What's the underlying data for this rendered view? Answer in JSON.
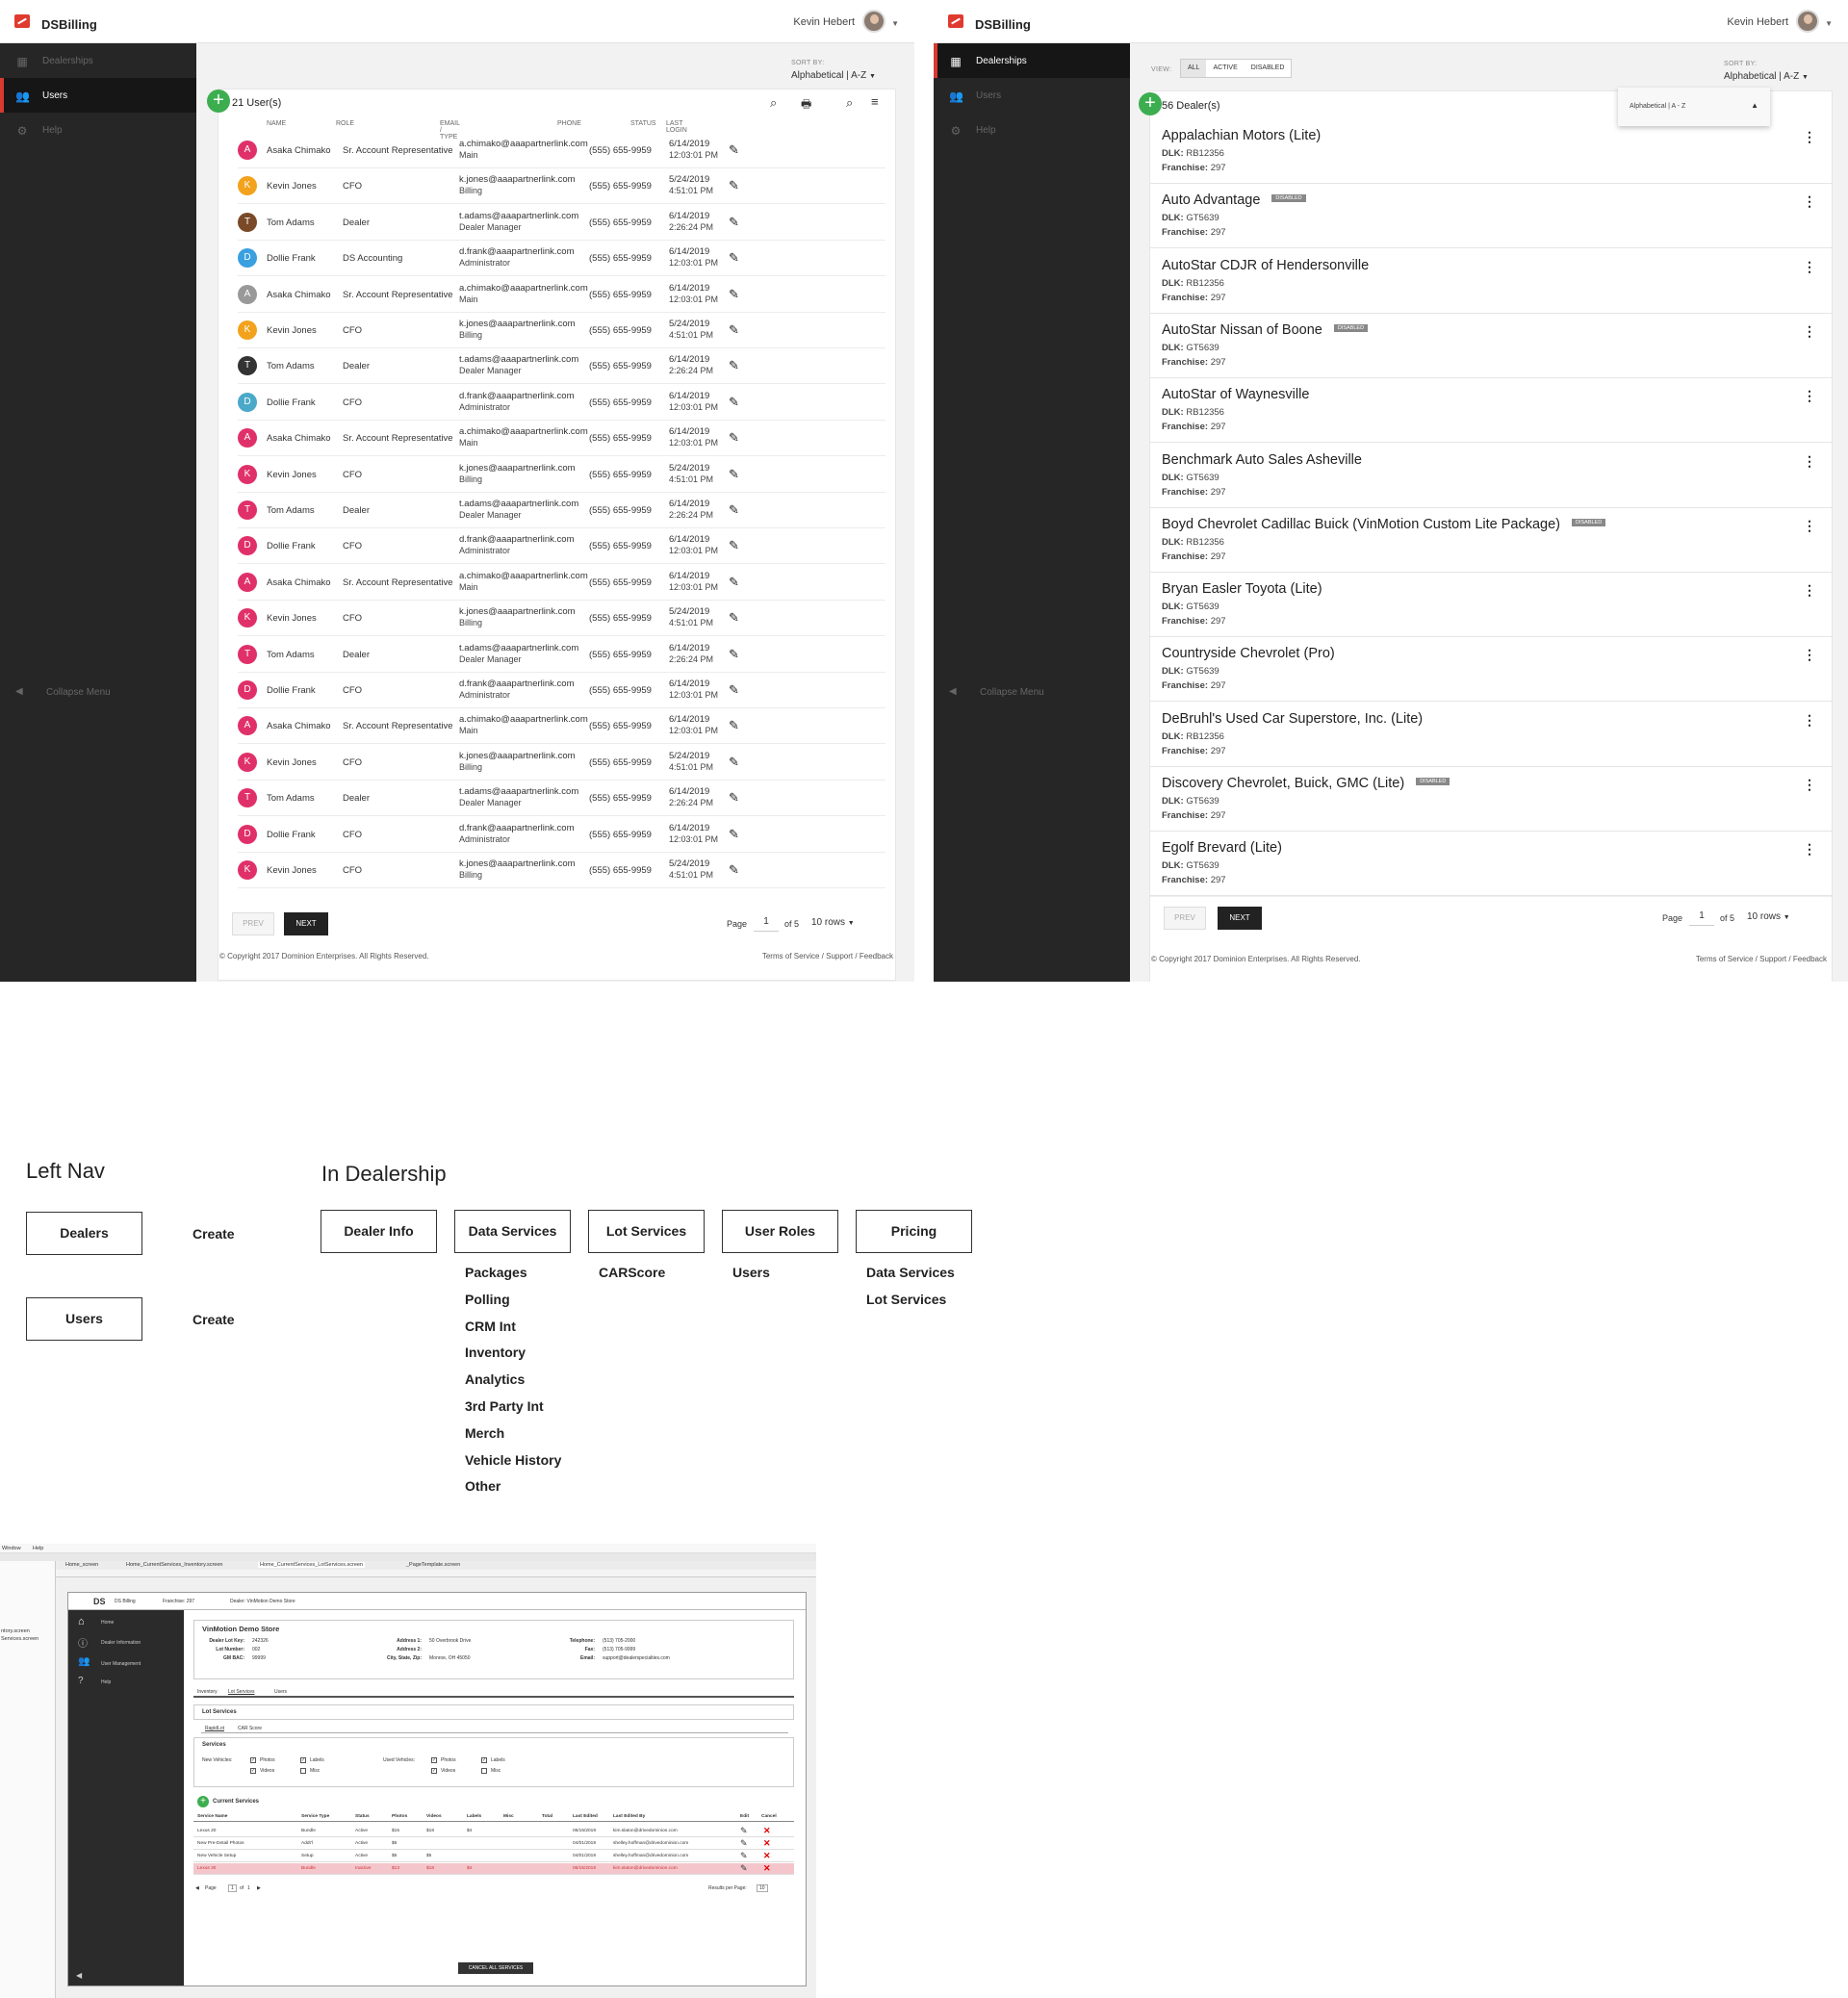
{
  "app_title": "DSBilling",
  "user_name": "Kevin Hebert",
  "nav": {
    "dealerships": "Dealerships",
    "users": "Users",
    "help": "Help",
    "collapse": "Collapse Menu"
  },
  "sort": {
    "label": "SORT BY:",
    "value": "Alphabetical | A-Z"
  },
  "users_screen": {
    "count_label": "21 User(s)",
    "columns": [
      "NAME",
      "ROLE",
      "EMAIL / TYPE",
      "PHONE",
      "STATUS",
      "LAST LOGIN"
    ],
    "rows": [
      {
        "initial": "A",
        "color": "#e0306a",
        "name": "Asaka Chimako",
        "role": "Sr. Account Representative",
        "email": "a.chimako@aaapartnerlink.com",
        "type": "Main",
        "phone": "(555) 655-9959",
        "date": "6/14/2019",
        "time": "12:03:01 PM"
      },
      {
        "initial": "K",
        "color": "#f2a21c",
        "name": "Kevin Jones",
        "role": "CFO",
        "email": "k.jones@aaapartnerlink.com",
        "type": "Billing",
        "phone": "(555) 655-9959",
        "date": "5/24/2019",
        "time": "4:51:01 PM"
      },
      {
        "initial": "T",
        "color": "#7a4a28",
        "name": "Tom Adams",
        "role": "Dealer",
        "email": "t.adams@aaapartnerlink.com",
        "type": "Dealer Manager",
        "phone": "(555) 655-9959",
        "date": "6/14/2019",
        "time": "2:26:24 PM"
      },
      {
        "initial": "D",
        "color": "#3aa0e0",
        "name": "Dollie Frank",
        "role": "DS Accounting",
        "email": "d.frank@aaapartnerlink.com",
        "type": "Administrator",
        "phone": "(555) 655-9959",
        "date": "6/14/2019",
        "time": "12:03:01 PM"
      },
      {
        "initial": "A",
        "color": "#999999",
        "name": "Asaka Chimako",
        "role": "Sr. Account Representative",
        "email": "a.chimako@aaapartnerlink.com",
        "type": "Main",
        "phone": "(555) 655-9959",
        "date": "6/14/2019",
        "time": "12:03:01 PM"
      },
      {
        "initial": "K",
        "color": "#f2a21c",
        "name": "Kevin Jones",
        "role": "CFO",
        "email": "k.jones@aaapartnerlink.com",
        "type": "Billing",
        "phone": "(555) 655-9959",
        "date": "5/24/2019",
        "time": "4:51:01 PM"
      },
      {
        "initial": "T",
        "color": "#333333",
        "name": "Tom Adams",
        "role": "Dealer",
        "email": "t.adams@aaapartnerlink.com",
        "type": "Dealer Manager",
        "phone": "(555) 655-9959",
        "date": "6/14/2019",
        "time": "2:26:24 PM"
      },
      {
        "initial": "D",
        "color": "#4aa8c8",
        "name": "Dollie Frank",
        "role": "CFO",
        "email": "d.frank@aaapartnerlink.com",
        "type": "Administrator",
        "phone": "(555) 655-9959",
        "date": "6/14/2019",
        "time": "12:03:01 PM"
      },
      {
        "initial": "A",
        "color": "#e0306a",
        "name": "Asaka Chimako",
        "role": "Sr. Account Representative",
        "email": "a.chimako@aaapartnerlink.com",
        "type": "Main",
        "phone": "(555) 655-9959",
        "date": "6/14/2019",
        "time": "12:03:01 PM"
      },
      {
        "initial": "K",
        "color": "#e0306a",
        "name": "Kevin Jones",
        "role": "CFO",
        "email": "k.jones@aaapartnerlink.com",
        "type": "Billing",
        "phone": "(555) 655-9959",
        "date": "5/24/2019",
        "time": "4:51:01 PM"
      },
      {
        "initial": "T",
        "color": "#e0306a",
        "name": "Tom Adams",
        "role": "Dealer",
        "email": "t.adams@aaapartnerlink.com",
        "type": "Dealer Manager",
        "phone": "(555) 655-9959",
        "date": "6/14/2019",
        "time": "2:26:24 PM"
      },
      {
        "initial": "D",
        "color": "#e0306a",
        "name": "Dollie Frank",
        "role": "CFO",
        "email": "d.frank@aaapartnerlink.com",
        "type": "Administrator",
        "phone": "(555) 655-9959",
        "date": "6/14/2019",
        "time": "12:03:01 PM"
      },
      {
        "initial": "A",
        "color": "#e0306a",
        "name": "Asaka Chimako",
        "role": "Sr. Account Representative",
        "email": "a.chimako@aaapartnerlink.com",
        "type": "Main",
        "phone": "(555) 655-9959",
        "date": "6/14/2019",
        "time": "12:03:01 PM"
      },
      {
        "initial": "K",
        "color": "#e0306a",
        "name": "Kevin Jones",
        "role": "CFO",
        "email": "k.jones@aaapartnerlink.com",
        "type": "Billing",
        "phone": "(555) 655-9959",
        "date": "5/24/2019",
        "time": "4:51:01 PM"
      },
      {
        "initial": "T",
        "color": "#e0306a",
        "name": "Tom Adams",
        "role": "Dealer",
        "email": "t.adams@aaapartnerlink.com",
        "type": "Dealer Manager",
        "phone": "(555) 655-9959",
        "date": "6/14/2019",
        "time": "2:26:24 PM"
      },
      {
        "initial": "D",
        "color": "#e0306a",
        "name": "Dollie Frank",
        "role": "CFO",
        "email": "d.frank@aaapartnerlink.com",
        "type": "Administrator",
        "phone": "(555) 655-9959",
        "date": "6/14/2019",
        "time": "12:03:01 PM"
      },
      {
        "initial": "A",
        "color": "#e0306a",
        "name": "Asaka Chimako",
        "role": "Sr. Account Representative",
        "email": "a.chimako@aaapartnerlink.com",
        "type": "Main",
        "phone": "(555) 655-9959",
        "date": "6/14/2019",
        "time": "12:03:01 PM"
      },
      {
        "initial": "K",
        "color": "#e0306a",
        "name": "Kevin Jones",
        "role": "CFO",
        "email": "k.jones@aaapartnerlink.com",
        "type": "Billing",
        "phone": "(555) 655-9959",
        "date": "5/24/2019",
        "time": "4:51:01 PM"
      },
      {
        "initial": "T",
        "color": "#e0306a",
        "name": "Tom Adams",
        "role": "Dealer",
        "email": "t.adams@aaapartnerlink.com",
        "type": "Dealer Manager",
        "phone": "(555) 655-9959",
        "date": "6/14/2019",
        "time": "2:26:24 PM"
      },
      {
        "initial": "D",
        "color": "#e0306a",
        "name": "Dollie Frank",
        "role": "CFO",
        "email": "d.frank@aaapartnerlink.com",
        "type": "Administrator",
        "phone": "(555) 655-9959",
        "date": "6/14/2019",
        "time": "12:03:01 PM"
      },
      {
        "initial": "K",
        "color": "#e0306a",
        "name": "Kevin Jones",
        "role": "CFO",
        "email": "k.jones@aaapartnerlink.com",
        "type": "Billing",
        "phone": "(555) 655-9959",
        "date": "5/24/2019",
        "time": "4:51:01 PM"
      }
    ]
  },
  "pager": {
    "prev": "PREV",
    "next": "NEXT",
    "page_label": "Page",
    "page_value": "1",
    "of_label": "of 5",
    "rows": "10 rows"
  },
  "footer": {
    "copyright": "© Copyright 2017 Dominion Enterprises. All Rights Reserved.",
    "terms": "Terms of Service",
    "support": "Support",
    "feedback": "Feedback",
    "sep": "/"
  },
  "dealers_screen": {
    "view_label": "VIEW:",
    "view_options": [
      "ALL",
      "ACTIVE",
      "DISABLED"
    ],
    "count_label": "56 Dealer(s)",
    "sort_dropdown": "Alphabetical | A - Z",
    "dlk_label": "DLK:",
    "franchise_label": "Franchise:",
    "disabled_badge": "DISABLED",
    "dealers": [
      {
        "name": "Appalachian Motors (Lite)",
        "disabled": false,
        "dlk": "RB12356",
        "franchise": "297"
      },
      {
        "name": "Auto Advantage",
        "disabled": true,
        "dlk": "GT5639",
        "franchise": "297"
      },
      {
        "name": "AutoStar CDJR of Hendersonville",
        "disabled": false,
        "dlk": "RB12356",
        "franchise": "297"
      },
      {
        "name": "AutoStar Nissan of Boone",
        "disabled": true,
        "dlk": "GT5639",
        "franchise": "297"
      },
      {
        "name": "AutoStar of Waynesville",
        "disabled": false,
        "dlk": "RB12356",
        "franchise": "297"
      },
      {
        "name": "Benchmark Auto Sales Asheville",
        "disabled": false,
        "dlk": "GT5639",
        "franchise": "297"
      },
      {
        "name": "Boyd Chevrolet Cadillac Buick (VinMotion Custom Lite Package)",
        "disabled": true,
        "dlk": "RB12356",
        "franchise": "297"
      },
      {
        "name": "Bryan Easler Toyota (Lite)",
        "disabled": false,
        "dlk": "GT5639",
        "franchise": "297"
      },
      {
        "name": "Countryside Chevrolet (Pro)",
        "disabled": false,
        "dlk": "GT5639",
        "franchise": "297"
      },
      {
        "name": "DeBruhl's Used Car Superstore, Inc. (Lite)",
        "disabled": false,
        "dlk": "RB12356",
        "franchise": "297"
      },
      {
        "name": "Discovery Chevrolet, Buick, GMC (Lite)",
        "disabled": true,
        "dlk": "GT5639",
        "franchise": "297"
      },
      {
        "name": "Egolf Brevard (Lite)",
        "disabled": false,
        "dlk": "GT5639",
        "franchise": "297"
      }
    ]
  },
  "sitemap": {
    "left_nav_title": "Left Nav",
    "left_nav": [
      {
        "box": "Dealers",
        "action": "Create"
      },
      {
        "box": "Users",
        "action": "Create"
      }
    ],
    "in_dealership_title": "In Dealership",
    "boxes": [
      "Dealer Info",
      "Data Services",
      "Lot Services",
      "User Roles",
      "Pricing"
    ],
    "data_services_items": [
      "Packages",
      "Polling",
      "CRM Int",
      "Inventory",
      "Analytics",
      "3rd Party Int",
      "Merch",
      "Vehicle History",
      "Other"
    ],
    "lot_services_items": [
      "CARScore"
    ],
    "user_roles_items": [
      "Users"
    ],
    "pricing_items": [
      "Data Services",
      "Lot Services"
    ]
  },
  "embedded": {
    "menu": [
      "Window",
      "Help"
    ],
    "tabs": [
      "Home_screen",
      "Home_CurrentServices_Inventory.screen",
      "Home_CurrentServices_LotServices.screen",
      "_PageTemplate.screen"
    ],
    "left_files": [
      "ntory.screen",
      "Services.screen"
    ],
    "header": {
      "brand": "DS",
      "app": "DS Billing",
      "franchise": "Franchise:  297",
      "dealer": "Dealer:  VinMotion Demo Store"
    },
    "nav": [
      "Home",
      "Dealer Information",
      "User Management",
      "Help"
    ],
    "store_name": "VinMotion Demo Store",
    "info_left": [
      [
        "Dealer Lot Key:",
        "242326"
      ],
      [
        "Lot Number:",
        "002"
      ],
      [
        "GM BAC:",
        "99999"
      ]
    ],
    "info_mid": [
      [
        "Address 1:",
        "50 Overbrook Drive"
      ],
      [
        "Address 2:",
        ""
      ],
      [
        "City, State, Zip:",
        "Monroe, OH 45050"
      ]
    ],
    "info_right": [
      [
        "Telephone:",
        "(513) 705-2000"
      ],
      [
        "Fax:",
        "(513) 705-9999"
      ],
      [
        "Email:",
        "support@dealerspecialties.com"
      ]
    ],
    "sub_tabs": [
      "Inventory",
      "Lot Services",
      "Users"
    ],
    "lot_services_title": "Lot Services",
    "inner_tabs": [
      "RapidLot",
      "CAR Score"
    ],
    "services_title": "Services",
    "new_vehicles": "New Vehicles:",
    "used_vehicles": "Used Vehicles:",
    "checks": [
      "Photos",
      "Labels",
      "Videos",
      "Misc"
    ],
    "current_services": "Current Services",
    "table_cols": [
      "Service Name",
      "Service Type",
      "Status",
      "Photos",
      "Videos",
      "Labels",
      "Misc",
      "Total",
      "Last Edited",
      "Last Edited By",
      "Edit",
      "Cancel"
    ],
    "table_rows": [
      [
        "Lexus 20",
        "Bundle",
        "Active",
        "$15",
        "$18",
        "$4",
        "",
        "",
        "06/15/2019",
        "kim.slaton@drivedominion.com"
      ],
      [
        "New Pre-Detail Photos",
        "Addt'l",
        "Active",
        "$6",
        "",
        "",
        "",
        "",
        "04/01/2019",
        "shelley.hoffman@drivedominion.com"
      ],
      [
        "New Vehicle Setup",
        "Setup",
        "Active",
        "$5",
        "$5",
        "",
        "",
        "",
        "04/01/2019",
        "shelley.hoffman@drivedominion.com"
      ],
      [
        "Lexus 30",
        "Bundle",
        "Inactive",
        "$13",
        "$18",
        "$4",
        "",
        "",
        "06/15/2019",
        "kim.slaton@drivedominion.com"
      ]
    ],
    "page": "Page",
    "page_value": "1",
    "of": "of",
    "of_value": "1",
    "results_per_page": "Results per Page:",
    "results_value": "10",
    "cancel_all": "CANCEL ALL SERVICES"
  }
}
